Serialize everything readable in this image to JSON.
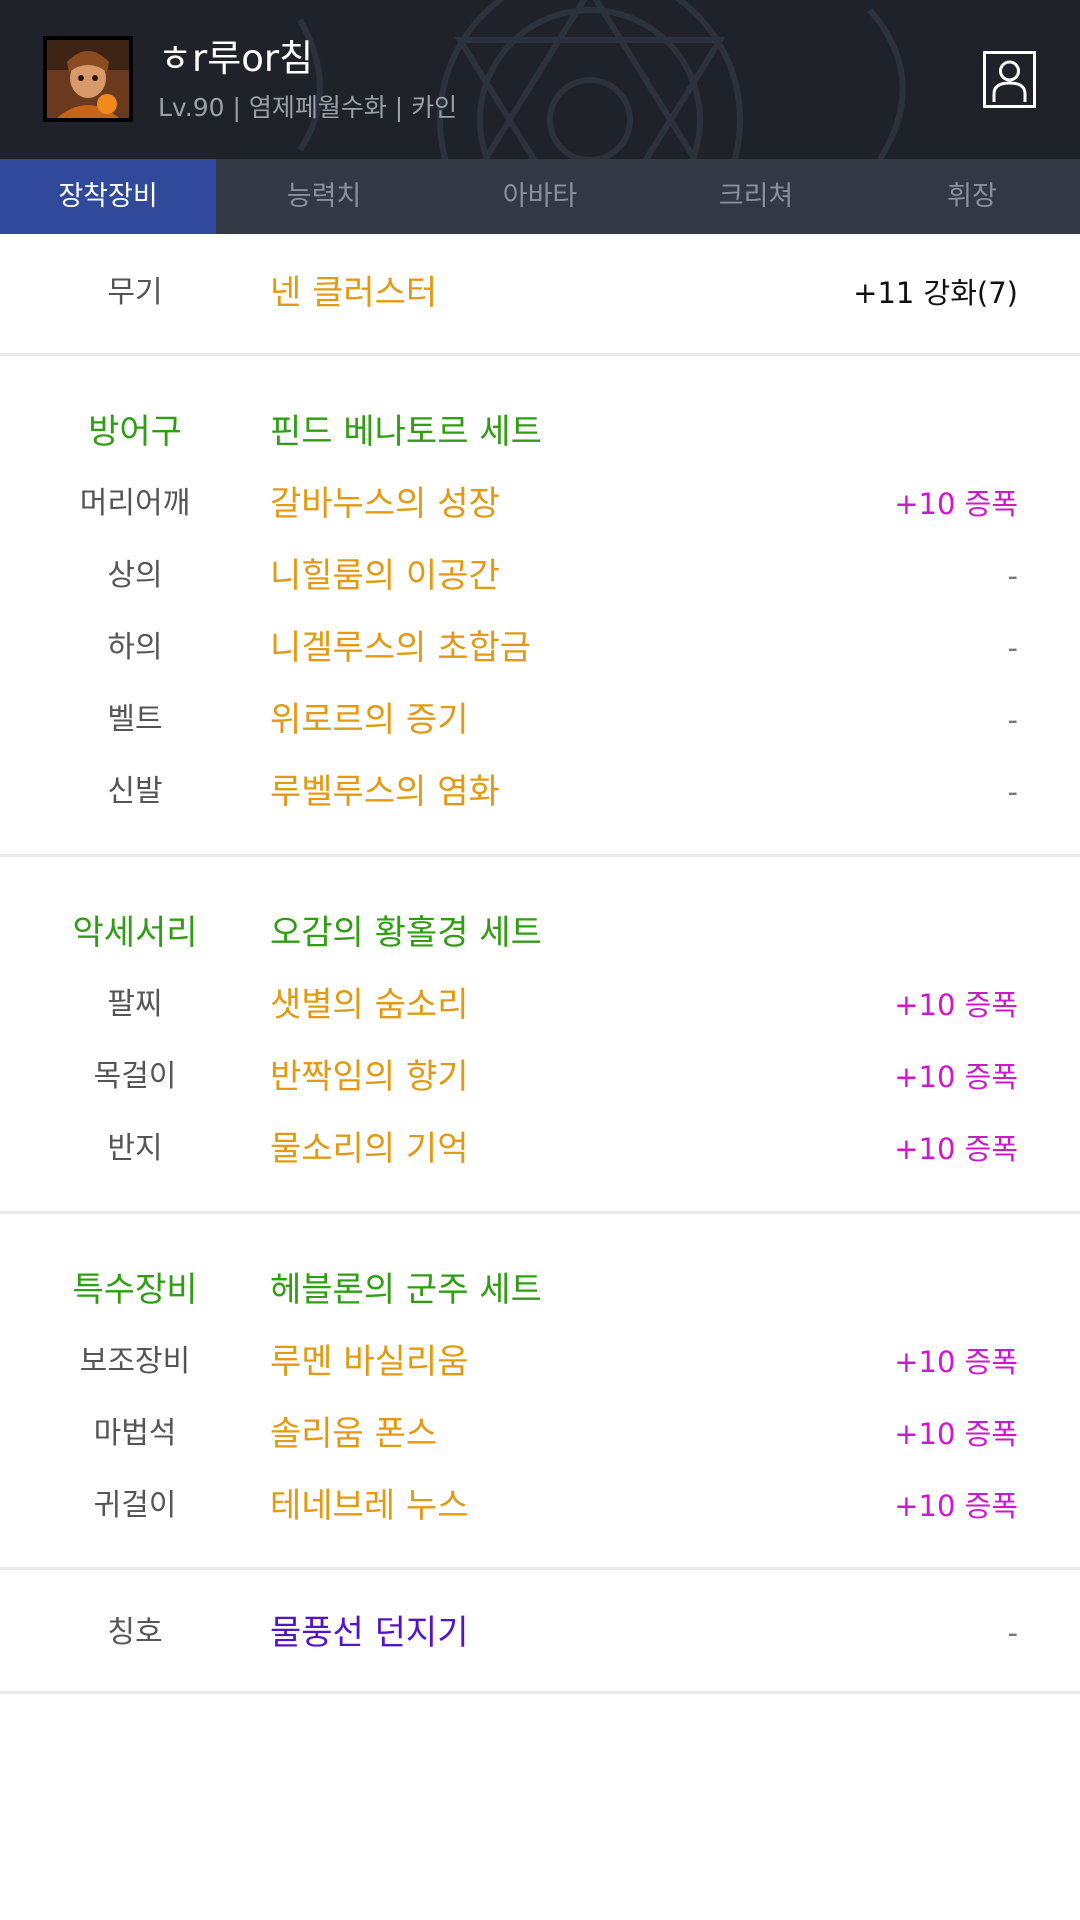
{
  "header": {
    "character_name": "ㅎr루or침",
    "character_info": "Lv.90 | 염제페월수화 | 카인",
    "avatar_icon": "character-portrait",
    "profile_icon": "person-icon"
  },
  "tabs": [
    {
      "label": "장착장비",
      "active": true
    },
    {
      "label": "능력치",
      "active": false
    },
    {
      "label": "아바타",
      "active": false
    },
    {
      "label": "크리쳐",
      "active": false
    },
    {
      "label": "휘장",
      "active": false
    }
  ],
  "weapon": {
    "label": "무기",
    "item": "넨 클러스터",
    "value": "+11 강화(7)"
  },
  "armor": {
    "group_label": "방어구",
    "set_name": "핀드 베나토르 세트",
    "items": [
      {
        "label": "머리어깨",
        "item": "갈바누스의 성장",
        "value": "+10 증폭"
      },
      {
        "label": "상의",
        "item": "니힐룸의 이공간",
        "value": "-"
      },
      {
        "label": "하의",
        "item": "니겔루스의 초합금",
        "value": "-"
      },
      {
        "label": "벨트",
        "item": "위로르의 증기",
        "value": "-"
      },
      {
        "label": "신발",
        "item": "루벨루스의 염화",
        "value": "-"
      }
    ]
  },
  "accessory": {
    "group_label": "악세서리",
    "set_name": "오감의 황홀경 세트",
    "items": [
      {
        "label": "팔찌",
        "item": "샛별의 숨소리",
        "value": "+10 증폭"
      },
      {
        "label": "목걸이",
        "item": "반짝임의 향기",
        "value": "+10 증폭"
      },
      {
        "label": "반지",
        "item": "물소리의 기억",
        "value": "+10 증폭"
      }
    ]
  },
  "special": {
    "group_label": "특수장비",
    "set_name": "헤블론의 군주 세트",
    "items": [
      {
        "label": "보조장비",
        "item": "루멘 바실리움",
        "value": "+10 증폭"
      },
      {
        "label": "마법석",
        "item": "솔리움 폰스",
        "value": "+10 증폭"
      },
      {
        "label": "귀걸이",
        "item": "테네브레 누스",
        "value": "+10 증폭"
      }
    ]
  },
  "title": {
    "label": "칭호",
    "item": "물풍선 던지기",
    "value": "-"
  },
  "colors": {
    "header_bg": "#1f2329",
    "tab_bg": "#323844",
    "tab_active": "#30499a",
    "set_green": "#2f9e12",
    "item_orange": "#e39a12",
    "amplify_magenta": "#d116d1",
    "title_purple": "#5214c4"
  }
}
